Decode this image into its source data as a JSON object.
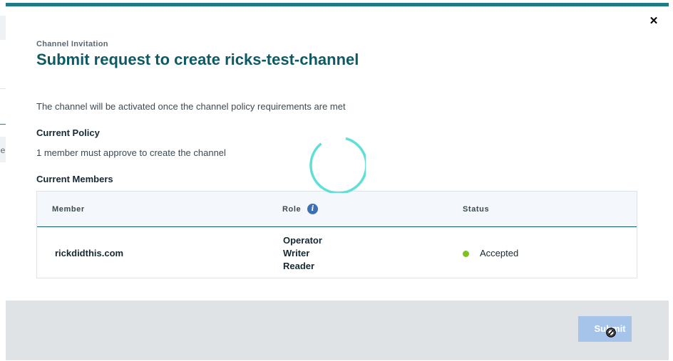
{
  "background": {
    "clipped_text": "ne"
  },
  "modal": {
    "close_label": "✕",
    "eyebrow": "Channel Invitation",
    "title": "Submit request to create ricks-test-channel",
    "description": "The channel will be activated once the channel policy requirements are met",
    "policy_heading": "Current Policy",
    "policy_text": "1 member must approve to create the channel",
    "members_heading": "Current Members",
    "table": {
      "headers": {
        "member": "Member",
        "role": "Role",
        "status": "Status"
      },
      "info_glyph": "i",
      "rows": [
        {
          "member": "rickdidthis.com",
          "roles": [
            "Operator",
            "Writer",
            "Reader"
          ],
          "status": "Accepted",
          "status_color": "#7cc31f"
        }
      ]
    },
    "loading": true,
    "submit_label": "Submit",
    "submit_disabled": true
  },
  "colors": {
    "accent": "#1f7a87",
    "title": "#0e5a64",
    "spinner": "#5fe0d6",
    "submit_disabled": "#a6c3ea",
    "info_icon": "#3d70b2"
  },
  "icons": {
    "close": "close-icon",
    "info": "info-icon",
    "spinner": "loading-spinner-icon",
    "cursor": "not-allowed-cursor-icon"
  }
}
